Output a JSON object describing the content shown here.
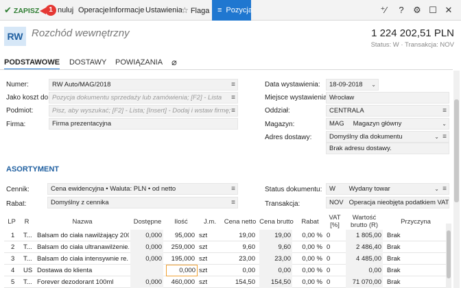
{
  "toolbar": {
    "save_label": "ZAPISZ",
    "badge": "1",
    "cancel_label": "nuluj",
    "operations_label": "Operacje",
    "info_label": "Informacje",
    "settings_label": "Ustawienia",
    "flag_label": "Flaga",
    "position_label": "Pozycja",
    "icons": [
      "add-person-icon",
      "help-icon",
      "gear-icon",
      "maximize-icon",
      "close-icon"
    ]
  },
  "header": {
    "doc_code": "RW",
    "title": "Rozchód wewnętrzny",
    "amount": "1 224 202,51 PLN",
    "status": "Status: W · Transakcja: NOV"
  },
  "tabs": [
    "PODSTAWOWE",
    "DOSTAWY",
    "POWIĄZANIA"
  ],
  "form": {
    "numer_label": "Numer:",
    "numer_value": "RW Auto/MAG/2018",
    "koszt_label": "Jako koszt do:",
    "koszt_placeholder": "Pozycja dokumentu sprzedaży lub zamówienia; [F2] - Lista",
    "podmiot_label": "Podmiot:",
    "podmiot_placeholder": "Pisz, aby wyszukać; [F2] - Lista; [Insert] - Dodaj i wstaw firmę;",
    "firma_label": "Firma:",
    "firma_value": "Firma prezentacyjna",
    "data_label": "Data wystawienia:",
    "data_value": "18-09-2018",
    "miejsce_label": "Miejsce wystawienia:",
    "miejsce_value": "Wrocław",
    "oddzial_label": "Oddział:",
    "oddzial_value": "CENTRALA",
    "magazyn_label": "Magazyn:",
    "magazyn_code": "MAG",
    "magazyn_value": "Magazyn główny",
    "adres_label": "Adres dostawy:",
    "adres_value": "Domyślny dla dokumentu",
    "adres_note": "Brak adresu dostawy."
  },
  "asortyment": {
    "title": "ASORTYMENT",
    "cennik_label": "Cennik:",
    "cennik_value": "Cena ewidencyjna • Waluta: PLN • od netto",
    "rabat_label": "Rabat:",
    "rabat_value": "Domyślny z cennika",
    "status_label": "Status dokumentu:",
    "status_code": "W",
    "status_value": "Wydany towar",
    "transakcja_label": "Transakcja:",
    "transakcja_code": "NOV",
    "transakcja_value": "Operacja nieobjęta podatkiem VAT"
  },
  "table": {
    "headers": [
      "LP",
      "R",
      "Nazwa",
      "Dostępne",
      "Ilość",
      "J.m.",
      "Cena netto",
      "Cena brutto",
      "Rabat",
      "VAT [%]",
      "Wartość brutto (R)",
      "Przyczyna"
    ],
    "rows": [
      {
        "lp": "1",
        "r": "T...",
        "nazwa": "Balsam do ciała nawilżający 200...",
        "dostepne": "0,000",
        "ilosc": "95,000",
        "jm": "szt",
        "netto": "19,00",
        "brutto": "19,00",
        "rabat": "0,00 %",
        "vat": "0",
        "wartosc": "1 805,00",
        "przyczyna": "Brak"
      },
      {
        "lp": "2",
        "r": "T...",
        "nazwa": "Balsam do ciała ultranawilżenie...",
        "dostepne": "0,000",
        "ilosc": "259,000",
        "jm": "szt",
        "netto": "9,60",
        "brutto": "9,60",
        "rabat": "0,00 %",
        "vat": "0",
        "wartosc": "2 486,40",
        "przyczyna": "Brak"
      },
      {
        "lp": "3",
        "r": "T...",
        "nazwa": "Balsam do ciała intensywnie re...",
        "dostepne": "0,000",
        "ilosc": "195,000",
        "jm": "szt",
        "netto": "23,00",
        "brutto": "23,00",
        "rabat": "0,00 %",
        "vat": "0",
        "wartosc": "4 485,00",
        "przyczyna": "Brak"
      },
      {
        "lp": "4",
        "r": "US",
        "nazwa": "Dostawa do klienta",
        "dostepne": "",
        "ilosc": "0,000",
        "jm": "szt",
        "netto": "0,00",
        "brutto": "0,00",
        "rabat": "0,00 %",
        "vat": "0",
        "wartosc": "0,00",
        "przyczyna": "Brak"
      },
      {
        "lp": "5",
        "r": "T...",
        "nazwa": "Forever dezodorant 100ml",
        "dostepne": "0,000",
        "ilosc": "460,000",
        "jm": "szt",
        "netto": "154,50",
        "brutto": "154,50",
        "rabat": "0,00 %",
        "vat": "0",
        "wartosc": "71 070,00",
        "przyczyna": "Brak"
      }
    ]
  }
}
